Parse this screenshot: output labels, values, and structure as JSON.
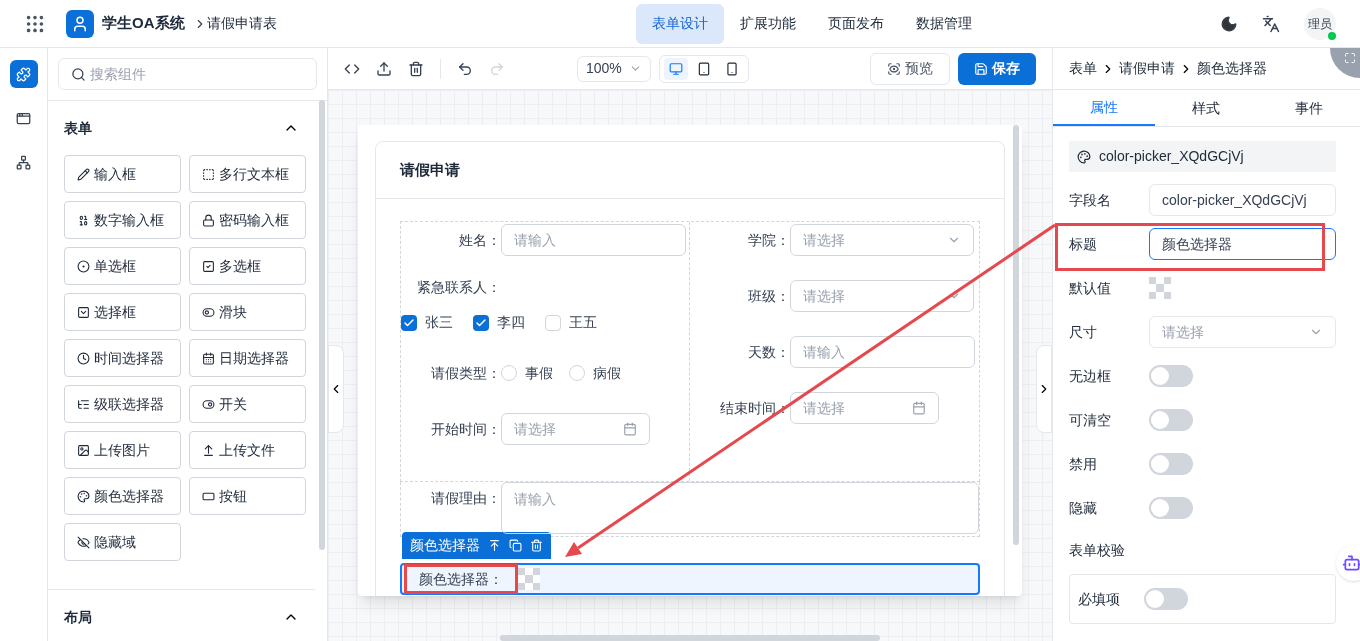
{
  "header": {
    "app_title": "学生OA系统",
    "breadcrumb": "请假申请表",
    "nav": [
      {
        "label": "表单设计",
        "selected": true
      },
      {
        "label": "扩展功能",
        "selected": false
      },
      {
        "label": "页面发布",
        "selected": false
      },
      {
        "label": "数据管理",
        "selected": false
      }
    ],
    "avatar": "理员"
  },
  "rail": [
    {
      "selected": true
    },
    {
      "selected": false
    },
    {
      "selected": false
    }
  ],
  "palette": {
    "search_placeholder": "搜索组件",
    "sections": [
      {
        "title": "表单",
        "expanded": true,
        "items": [
          "输入框",
          "多行文本框",
          "数字输入框",
          "密码输入框",
          "单选框",
          "多选框",
          "选择框",
          "滑块",
          "时间选择器",
          "日期选择器",
          "级联选择器",
          "开关",
          "上传图片",
          "上传文件",
          "颜色选择器",
          "按钮",
          "隐藏域"
        ]
      },
      {
        "title": "布局",
        "expanded": true
      }
    ]
  },
  "toolbar": {
    "zoom": "100%",
    "devices": [
      {
        "selected": true
      },
      {
        "selected": false
      },
      {
        "selected": false
      }
    ],
    "preview": "预览",
    "save": "保存"
  },
  "form": {
    "title": "请假申请",
    "left": [
      {
        "kind": "input",
        "label": "姓名：",
        "placeholder": "请输入"
      },
      {
        "kind": "checkbox",
        "label": "紧急联系人：",
        "options": [
          {
            "label": "张三",
            "checked": true
          },
          {
            "label": "李四",
            "checked": true
          },
          {
            "label": "王五",
            "checked": false
          }
        ]
      },
      {
        "kind": "radio",
        "label": "请假类型：",
        "options": [
          {
            "label": "事假",
            "selected": false
          },
          {
            "label": "病假",
            "selected": false
          }
        ]
      },
      {
        "kind": "date",
        "label": "开始时间：",
        "placeholder": "请选择"
      }
    ],
    "right": [
      {
        "kind": "select",
        "label": "学院：",
        "placeholder": "请选择"
      },
      {
        "kind": "select",
        "label": "班级：",
        "placeholder": "请选择"
      },
      {
        "kind": "input",
        "label": "天数：",
        "placeholder": "请输入"
      },
      {
        "kind": "date",
        "label": "结束时间：",
        "placeholder": "请选择"
      }
    ],
    "reason": {
      "label": "请假理由：",
      "placeholder": "请输入"
    },
    "selected_field": {
      "toolbar_label": "颜色选择器",
      "label": "颜色选择器："
    }
  },
  "inspector": {
    "breadcrumb": [
      "表单",
      "请假申请",
      "颜色选择器"
    ],
    "tabs": [
      {
        "label": "属性",
        "selected": true
      },
      {
        "label": "样式",
        "selected": false
      },
      {
        "label": "事件",
        "selected": false
      }
    ],
    "component_id": "color-picker_XQdGCjVj",
    "props": [
      {
        "kind": "input",
        "label": "字段名",
        "value": "color-picker_XQdGCjVj",
        "focused": false
      },
      {
        "kind": "input",
        "label": "标题",
        "value": "颜色选择器",
        "focused": true
      },
      {
        "kind": "color",
        "label": "默认值"
      },
      {
        "kind": "select",
        "label": "尺寸",
        "placeholder": "请选择"
      },
      {
        "kind": "switch",
        "label": "无边框",
        "on": false
      },
      {
        "kind": "switch",
        "label": "可清空",
        "on": false
      },
      {
        "kind": "switch",
        "label": "禁用",
        "on": false
      },
      {
        "kind": "switch",
        "label": "隐藏",
        "on": false
      }
    ],
    "validation": {
      "title": "表单校验",
      "items": [
        {
          "label": "必填项",
          "on": false
        }
      ]
    }
  }
}
